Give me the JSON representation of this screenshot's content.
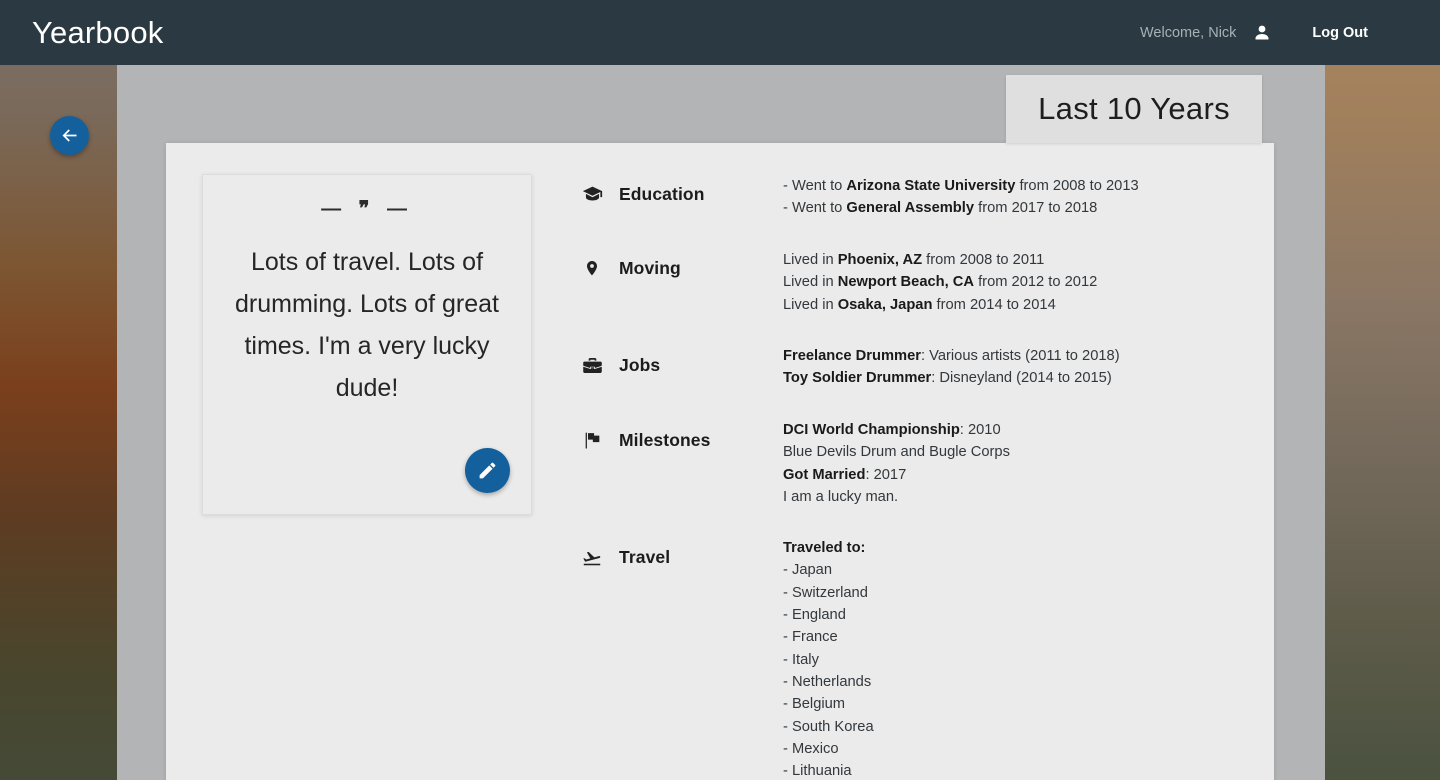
{
  "topbar": {
    "brand": "Yearbook",
    "welcome": "Welcome, Nick",
    "person_icon": "person-icon",
    "logout": "Log Out"
  },
  "page": {
    "title": "Last 10 Years",
    "back_icon": "arrow-left-icon"
  },
  "quote": {
    "ornament": "— ❞ —",
    "text": "Lots of travel. Lots of drumming. Lots of great times. I'm a very lucky dude!",
    "edit_icon": "pencil-icon"
  },
  "sections": [
    {
      "icon": "graduation-cap-icon",
      "name": "Education",
      "lines": [
        {
          "parts": [
            {
              "t": "- Went to ",
              "b": false
            },
            {
              "t": "Arizona State University",
              "b": true
            },
            {
              "t": " from 2008 to 2013",
              "b": false
            }
          ]
        },
        {
          "parts": [
            {
              "t": "- Went to ",
              "b": false
            },
            {
              "t": "General Assembly",
              "b": true
            },
            {
              "t": " from 2017 to 2018",
              "b": false
            }
          ]
        }
      ]
    },
    {
      "icon": "map-pin-icon",
      "name": "Moving",
      "lines": [
        {
          "parts": [
            {
              "t": "Lived in ",
              "b": false
            },
            {
              "t": "Phoenix, AZ",
              "b": true
            },
            {
              "t": " from 2008 to 2011",
              "b": false
            }
          ]
        },
        {
          "parts": [
            {
              "t": "Lived in ",
              "b": false
            },
            {
              "t": "Newport Beach, CA",
              "b": true
            },
            {
              "t": " from 2012 to 2012",
              "b": false
            }
          ]
        },
        {
          "parts": [
            {
              "t": "Lived in ",
              "b": false
            },
            {
              "t": "Osaka, Japan",
              "b": true
            },
            {
              "t": " from 2014 to 2014",
              "b": false
            }
          ]
        }
      ]
    },
    {
      "icon": "briefcase-icon",
      "name": "Jobs",
      "lines": [
        {
          "parts": [
            {
              "t": "Freelance Drummer",
              "b": true
            },
            {
              "t": ": Various artists (2011 to 2018)",
              "b": false
            }
          ]
        },
        {
          "parts": [
            {
              "t": "Toy Soldier Drummer",
              "b": true
            },
            {
              "t": ": Disneyland (2014 to 2015)",
              "b": false
            }
          ]
        }
      ]
    },
    {
      "icon": "flag-icon",
      "name": "Milestones",
      "lines": [
        {
          "parts": [
            {
              "t": "DCI World Championship",
              "b": true
            },
            {
              "t": ": 2010",
              "b": false
            }
          ]
        },
        {
          "parts": [
            {
              "t": "Blue Devils Drum and Bugle Corps",
              "b": false
            }
          ]
        },
        {
          "parts": [
            {
              "t": "Got Married",
              "b": true
            },
            {
              "t": ": 2017",
              "b": false
            }
          ]
        },
        {
          "parts": [
            {
              "t": "I am a lucky man.",
              "b": false
            }
          ]
        }
      ]
    },
    {
      "icon": "airplane-takeoff-icon",
      "name": "Travel",
      "lines": [
        {
          "parts": [
            {
              "t": "Traveled to:",
              "b": true
            }
          ]
        },
        {
          "parts": [
            {
              "t": "- Japan",
              "b": false
            }
          ]
        },
        {
          "parts": [
            {
              "t": "- Switzerland",
              "b": false
            }
          ]
        },
        {
          "parts": [
            {
              "t": "- England",
              "b": false
            }
          ]
        },
        {
          "parts": [
            {
              "t": "- France",
              "b": false
            }
          ]
        },
        {
          "parts": [
            {
              "t": "- Italy",
              "b": false
            }
          ]
        },
        {
          "parts": [
            {
              "t": "- Netherlands",
              "b": false
            }
          ]
        },
        {
          "parts": [
            {
              "t": "- Belgium",
              "b": false
            }
          ]
        },
        {
          "parts": [
            {
              "t": "- South Korea",
              "b": false
            }
          ]
        },
        {
          "parts": [
            {
              "t": "- Mexico",
              "b": false
            }
          ]
        },
        {
          "parts": [
            {
              "t": "- Lithuania",
              "b": false
            }
          ]
        }
      ]
    }
  ],
  "colors": {
    "topbar": "#2b3a42",
    "accent_blue": "#14609c",
    "stage": "#b2b4b6",
    "card": "#ebebeb",
    "title_plate": "#dfdfdf"
  }
}
